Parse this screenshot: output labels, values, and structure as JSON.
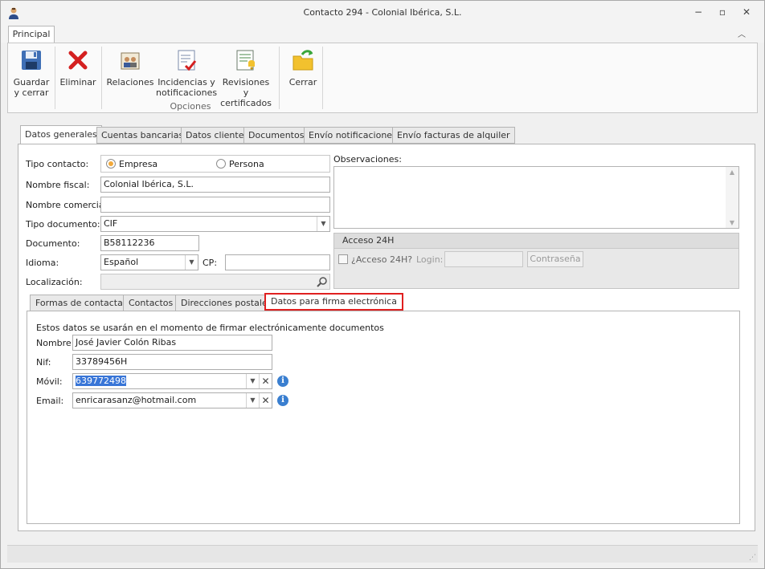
{
  "window": {
    "title": "Contacto 294 - Colonial Ibérica, S.L."
  },
  "ribbon": {
    "tab": "Principal",
    "buttons": {
      "guardar": "Guardar\ny cerrar",
      "eliminar": "Eliminar",
      "relaciones": "Relaciones",
      "incidencias": "Incidencias y\nnotificaciones",
      "revisiones": "Revisiones y\ncertificados",
      "cerrar": "Cerrar"
    },
    "group_label": "Opciones"
  },
  "tabs": [
    "Datos generales",
    "Cuentas bancarias",
    "Datos cliente",
    "Documentos",
    "Envío notificaciones",
    "Envío facturas de alquiler"
  ],
  "form": {
    "tipo_contacto_label": "Tipo contacto:",
    "empresa": "Empresa",
    "persona": "Persona",
    "nombre_fiscal_label": "Nombre fiscal:",
    "nombre_fiscal": "Colonial Ibérica, S.L.",
    "nombre_comercial_label": "Nombre comercial:",
    "nombre_comercial": "",
    "tipo_documento_label": "Tipo documento:",
    "tipo_documento": "CIF",
    "documento_label": "Documento:",
    "documento": "B58112236",
    "idioma_label": "Idioma:",
    "idioma": "Español",
    "cp_label": "CP:",
    "cp": "",
    "localizacion_label": "Localización:",
    "observaciones_label": "Observaciones:"
  },
  "acceso": {
    "header": "Acceso 24H",
    "check_label": "¿Acceso 24H?",
    "login_label": "Login:",
    "login": "",
    "password_button": "Contraseña"
  },
  "subtabs": [
    "Formas de contactar",
    "Contactos",
    "Direcciones postales",
    "Datos para firma electrónica"
  ],
  "firma": {
    "intro": "Estos datos se usarán en el momento de firmar electrónicamente documentos",
    "nombre_label": "Nombre:",
    "nombre": "José Javier Colón Ribas",
    "nif_label": "Nif:",
    "nif": "33789456H",
    "movil_label": "Móvil:",
    "movil": "639772498",
    "email_label": "Email:",
    "email": "enricarasanz@hotmail.com"
  }
}
